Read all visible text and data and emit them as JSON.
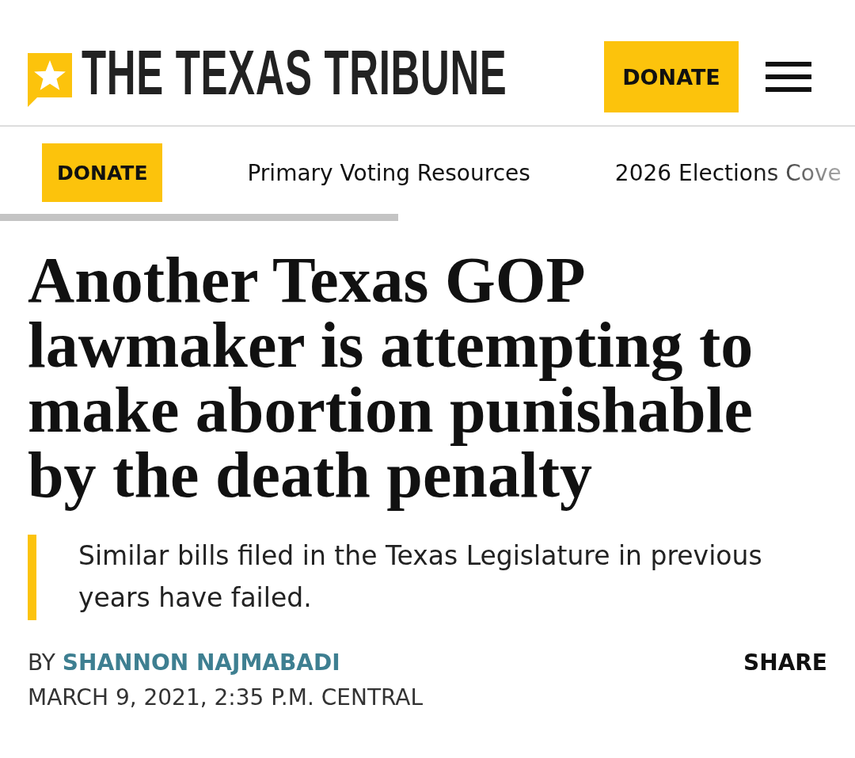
{
  "header": {
    "logo_text": "THE TEXAS TRIBUNE",
    "donate_button": "DONATE"
  },
  "nav": {
    "items": [
      {
        "label": "DONATE",
        "kind": "button"
      },
      {
        "label": "Primary Voting Resources",
        "kind": "link"
      },
      {
        "label": "2026 Elections Cove",
        "kind": "link"
      }
    ]
  },
  "article": {
    "headline": "Another Texas GOP lawmaker is attempting to make abortion punishable by the death penalty",
    "dek": "Similar bills filed in the Texas Legislature in previous years have failed.",
    "byline": {
      "prefix": "BY",
      "author": "SHANNON NAJMABADI"
    },
    "share": "SHARE",
    "dateline": "MARCH 9, 2021, 2:35 P.M. CENTRAL"
  }
}
